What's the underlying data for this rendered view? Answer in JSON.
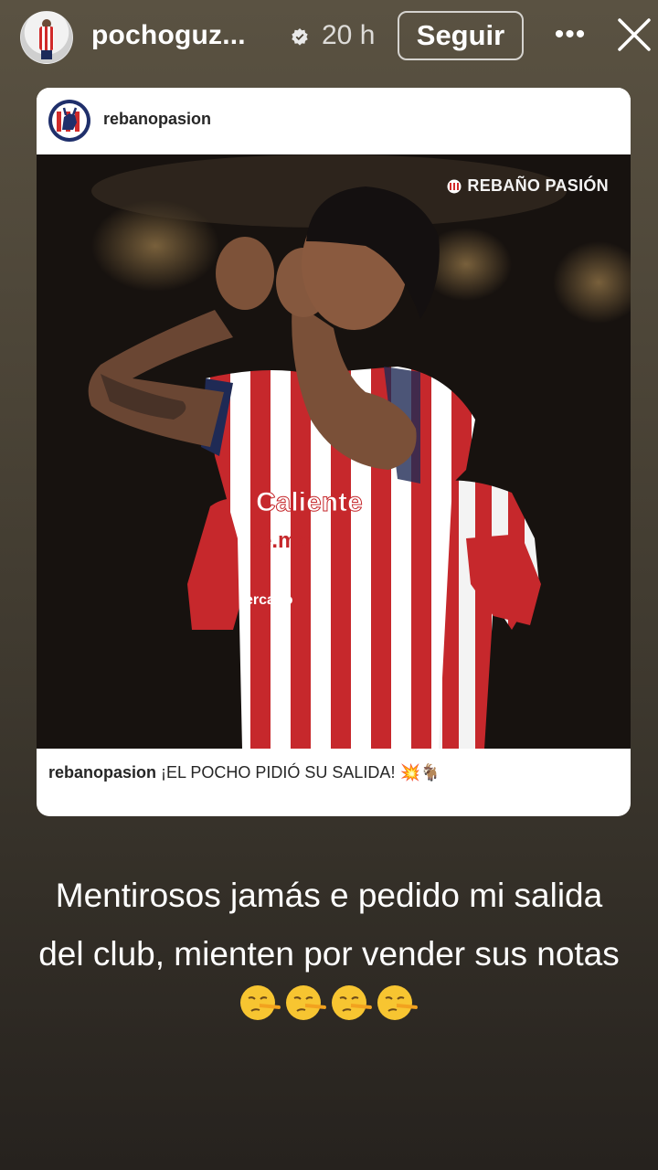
{
  "header": {
    "username": "pochoguz...",
    "time": "20 h",
    "follow_label": "Seguir",
    "more_label": "•••",
    "icons": {
      "verified": "verified-badge-icon",
      "more": "more-options-icon",
      "close": "close-icon"
    }
  },
  "shared_post": {
    "account": "rebanopasion",
    "watermark": "REBAÑO PASIÓN",
    "caption_user": "rebanopasion",
    "caption_text": "¡EL POCHO PIDIÓ SU SALIDA! 💥🐐",
    "jersey_sponsor_1": "Caliente",
    "jersey_sponsor_2": "te.mx",
    "jersey_sponsor_3": "ercado"
  },
  "story": {
    "text_line_1": "Mentirosos jamás e pedido mi salida",
    "text_line_2": "del club, mienten por vender sus notas",
    "emoji": "lying-face-emoji",
    "emoji_count": 4
  },
  "colors": {
    "chivas_red": "#d02a2a",
    "background_top": "#5a5242",
    "background_bottom": "#26221e"
  }
}
